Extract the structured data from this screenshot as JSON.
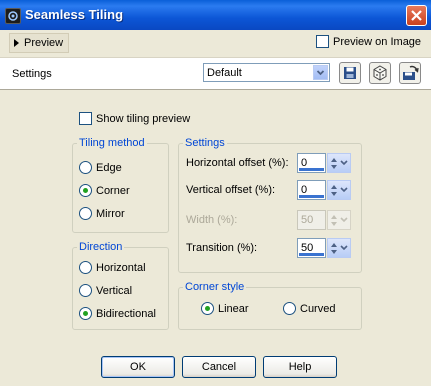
{
  "window": {
    "title": "Seamless Tiling"
  },
  "preview": {
    "toggle_label": "Preview",
    "on_image_label": "Preview on Image",
    "on_image_checked": false
  },
  "settings_bar": {
    "label": "Settings",
    "preset_value": "Default"
  },
  "show_tiling_preview": {
    "label": "Show tiling preview",
    "checked": false
  },
  "tiling_method": {
    "legend": "Tiling method",
    "options": [
      {
        "label": "Edge",
        "selected": false
      },
      {
        "label": "Corner",
        "selected": true
      },
      {
        "label": "Mirror",
        "selected": false
      }
    ]
  },
  "direction": {
    "legend": "Direction",
    "options": [
      {
        "label": "Horizontal",
        "selected": false
      },
      {
        "label": "Vertical",
        "selected": false
      },
      {
        "label": "Bidirectional",
        "selected": true
      }
    ]
  },
  "settings_group": {
    "legend": "Settings",
    "fields": [
      {
        "label": "Horizontal offset (%):",
        "value": "0",
        "enabled": true
      },
      {
        "label": "Vertical offset (%):",
        "value": "0",
        "enabled": true
      },
      {
        "label": "Width (%):",
        "value": "50",
        "enabled": false
      },
      {
        "label": "Transition (%):",
        "value": "50",
        "enabled": true
      }
    ]
  },
  "corner_style": {
    "legend": "Corner style",
    "options": [
      {
        "label": "Linear",
        "selected": true
      },
      {
        "label": "Curved",
        "selected": false
      }
    ]
  },
  "buttons": {
    "ok": "OK",
    "cancel": "Cancel",
    "help": "Help"
  },
  "icons": {
    "app": "app-icon",
    "close": "close-icon",
    "preview_toggle": "triangle-right-icon",
    "save_preset": "save-icon",
    "reset_preset": "reset-icon",
    "manage_presets": "preset-manager-icon",
    "dropdown": "chevron-down-icon",
    "spinner": "spinner-arrows-icon"
  },
  "colors": {
    "titlebar": "#0a5fd8",
    "legend_text": "#0046d5",
    "radio_dot": "#21a121",
    "dialog_bg": "#ece9d8"
  }
}
